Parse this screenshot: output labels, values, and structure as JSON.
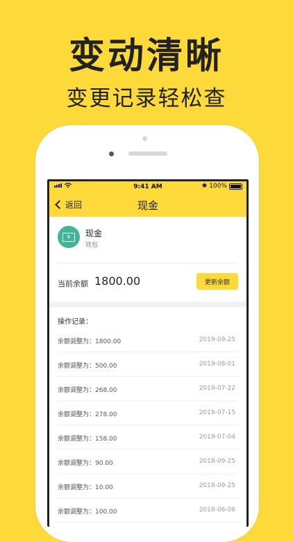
{
  "promo": {
    "headline": "变动清晰",
    "subline": "变更记录轻松查"
  },
  "status_bar": {
    "time": "9:41 AM",
    "battery": "100%"
  },
  "nav": {
    "back_label": "返回",
    "title": "现金"
  },
  "account": {
    "icon_glyph": "¥",
    "name": "现金",
    "type": "钱包",
    "icon_color": "#3FB59A"
  },
  "balance": {
    "label": "当前余额",
    "value": "1800.00",
    "update_label": "更新余额"
  },
  "records": {
    "title": "操作记录：",
    "items": [
      {
        "amount": "余额调整为：1800.00",
        "date": "2019-09-25"
      },
      {
        "amount": "余额调整为：500.00",
        "date": "2019-08-01"
      },
      {
        "amount": "余额调整为：268.00",
        "date": "2019-07-22"
      },
      {
        "amount": "余额调整为：278.00",
        "date": "2019-07-15"
      },
      {
        "amount": "余额调整为：158.00",
        "date": "2019-07-04"
      },
      {
        "amount": "余额调整为：90.00",
        "date": "2018-09-25"
      },
      {
        "amount": "余额调整为：10.00",
        "date": "2018-09-25"
      },
      {
        "amount": "余额调整为：100.00",
        "date": "2018-06-08"
      }
    ]
  },
  "colors": {
    "brand_yellow": "#FDD93A",
    "accent_green": "#3FB59A"
  }
}
